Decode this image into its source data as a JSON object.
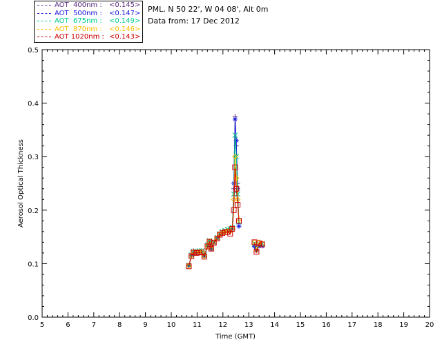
{
  "info": {
    "station": "PML, N 50 22', W 04 08', Alt 0m",
    "date": "Data from: 17 Dec 2012"
  },
  "legend": [
    {
      "label": "AOT  400nm : ",
      "value": "<0.145>",
      "color": "#5a2d82"
    },
    {
      "label": "AOT  500nm : ",
      "value": "<0.147>",
      "color": "#1a1adf"
    },
    {
      "label": "AOT  675nm : ",
      "value": "<0.149>",
      "color": "#00cc88"
    },
    {
      "label": "AOT  870nm : ",
      "value": "<0.146>",
      "color": "#ffbb00"
    },
    {
      "label": "AOT 1020nm : ",
      "value": "<0.143>",
      "color": "#cc0000"
    }
  ],
  "chart_data": {
    "type": "line",
    "xlabel": "Time (GMT)",
    "ylabel": "Aerosol Optical Thickness",
    "xlim": [
      5,
      20
    ],
    "ylim": [
      0,
      0.5
    ],
    "xticks": [
      "5",
      "6",
      "7",
      "8",
      "9",
      "10",
      "11",
      "12",
      "13",
      "14",
      "15",
      "16",
      "17",
      "18",
      "19",
      "20"
    ],
    "yticks": [
      "0.0",
      "0.1",
      "0.2",
      "0.3",
      "0.4",
      "0.5"
    ],
    "series": [
      {
        "name": "AOT 400nm",
        "color": "#5a2d82",
        "marker": "plus",
        "segments": [
          [
            [
              10.68,
              0.097
            ],
            [
              10.78,
              0.116
            ],
            [
              10.86,
              0.124
            ],
            [
              10.98,
              0.12
            ],
            [
              11.08,
              0.122
            ],
            [
              11.18,
              0.122
            ],
            [
              11.28,
              0.115
            ],
            [
              11.4,
              0.132
            ],
            [
              11.48,
              0.142
            ],
            [
              11.55,
              0.128
            ],
            [
              11.65,
              0.138
            ],
            [
              11.78,
              0.148
            ],
            [
              11.88,
              0.154
            ],
            [
              11.98,
              0.156
            ],
            [
              12.08,
              0.158
            ],
            [
              12.18,
              0.16
            ],
            [
              12.28,
              0.16
            ],
            [
              12.36,
              0.165
            ],
            [
              12.42,
              0.24
            ],
            [
              12.47,
              0.375
            ],
            [
              12.52,
              0.32
            ],
            [
              12.57,
              0.25
            ],
            [
              12.62,
              0.175
            ]
          ],
          [
            [
              13.22,
              0.135
            ],
            [
              13.3,
              0.125
            ],
            [
              13.4,
              0.135
            ],
            [
              13.52,
              0.135
            ]
          ]
        ]
      },
      {
        "name": "AOT 500nm",
        "color": "#1a1adf",
        "marker": "star",
        "segments": [
          [
            [
              10.68,
              0.096
            ],
            [
              10.78,
              0.115
            ],
            [
              10.86,
              0.122
            ],
            [
              10.98,
              0.12
            ],
            [
              11.08,
              0.121
            ],
            [
              11.18,
              0.121
            ],
            [
              11.28,
              0.114
            ],
            [
              11.4,
              0.134
            ],
            [
              11.48,
              0.141
            ],
            [
              11.55,
              0.127
            ],
            [
              11.65,
              0.139
            ],
            [
              11.78,
              0.147
            ],
            [
              11.88,
              0.155
            ],
            [
              11.98,
              0.159
            ],
            [
              12.08,
              0.161
            ],
            [
              12.18,
              0.162
            ],
            [
              12.28,
              0.163
            ],
            [
              12.36,
              0.165
            ],
            [
              12.42,
              0.25
            ],
            [
              12.47,
              0.37
            ],
            [
              12.52,
              0.33
            ],
            [
              12.57,
              0.24
            ],
            [
              12.62,
              0.17
            ]
          ],
          [
            [
              13.22,
              0.132
            ],
            [
              13.3,
              0.124
            ],
            [
              13.4,
              0.133
            ],
            [
              13.52,
              0.133
            ]
          ]
        ]
      },
      {
        "name": "AOT 675nm",
        "color": "#00cc88",
        "marker": "x",
        "segments": [
          [
            [
              10.68,
              0.097
            ],
            [
              10.78,
              0.116
            ],
            [
              10.86,
              0.123
            ],
            [
              10.98,
              0.122
            ],
            [
              11.08,
              0.124
            ],
            [
              11.18,
              0.124
            ],
            [
              11.28,
              0.116
            ],
            [
              11.4,
              0.135
            ],
            [
              11.48,
              0.143
            ],
            [
              11.55,
              0.13
            ],
            [
              11.65,
              0.141
            ],
            [
              11.78,
              0.149
            ],
            [
              11.88,
              0.156
            ],
            [
              11.98,
              0.16
            ],
            [
              12.08,
              0.162
            ],
            [
              12.18,
              0.164
            ],
            [
              12.28,
              0.165
            ],
            [
              12.36,
              0.168
            ],
            [
              12.42,
              0.23
            ],
            [
              12.47,
              0.34
            ],
            [
              12.52,
              0.3
            ],
            [
              12.57,
              0.23
            ],
            [
              12.62,
              0.178
            ]
          ],
          [
            [
              13.22,
              0.138
            ],
            [
              13.3,
              0.128
            ],
            [
              13.4,
              0.137
            ],
            [
              13.52,
              0.137
            ]
          ]
        ]
      },
      {
        "name": "AOT 870nm",
        "color": "#ffbb00",
        "marker": "diamond",
        "segments": [
          [
            [
              10.68,
              0.096
            ],
            [
              10.78,
              0.115
            ],
            [
              10.86,
              0.122
            ],
            [
              10.98,
              0.121
            ],
            [
              11.08,
              0.122
            ],
            [
              11.18,
              0.122
            ],
            [
              11.28,
              0.114
            ],
            [
              11.4,
              0.133
            ],
            [
              11.48,
              0.142
            ],
            [
              11.55,
              0.128
            ],
            [
              11.65,
              0.14
            ],
            [
              11.78,
              0.148
            ],
            [
              11.88,
              0.155
            ],
            [
              11.98,
              0.158
            ],
            [
              12.08,
              0.16
            ],
            [
              12.18,
              0.161
            ],
            [
              12.28,
              0.16
            ],
            [
              12.36,
              0.165
            ],
            [
              12.42,
              0.22
            ],
            [
              12.47,
              0.3
            ],
            [
              12.52,
              0.26
            ],
            [
              12.57,
              0.22
            ],
            [
              12.62,
              0.182
            ]
          ],
          [
            [
              13.22,
              0.14
            ],
            [
              13.3,
              0.125
            ],
            [
              13.4,
              0.14
            ],
            [
              13.52,
              0.138
            ]
          ]
        ]
      },
      {
        "name": "AOT 1020nm",
        "color": "#cc0000",
        "marker": "square",
        "segments": [
          [
            [
              10.68,
              0.095
            ],
            [
              10.78,
              0.114
            ],
            [
              10.86,
              0.121
            ],
            [
              10.98,
              0.12
            ],
            [
              11.08,
              0.121
            ],
            [
              11.18,
              0.121
            ],
            [
              11.28,
              0.113
            ],
            [
              11.4,
              0.132
            ],
            [
              11.48,
              0.141
            ],
            [
              11.55,
              0.128
            ],
            [
              11.65,
              0.139
            ],
            [
              11.78,
              0.147
            ],
            [
              11.88,
              0.154
            ],
            [
              11.98,
              0.157
            ],
            [
              12.08,
              0.159
            ],
            [
              12.18,
              0.159
            ],
            [
              12.28,
              0.156
            ],
            [
              12.36,
              0.165
            ],
            [
              12.42,
              0.2
            ],
            [
              12.47,
              0.28
            ],
            [
              12.52,
              0.24
            ],
            [
              12.57,
              0.21
            ],
            [
              12.62,
              0.18
            ]
          ],
          [
            [
              13.22,
              0.14
            ],
            [
              13.3,
              0.122
            ],
            [
              13.4,
              0.138
            ],
            [
              13.52,
              0.136
            ]
          ]
        ]
      }
    ]
  }
}
